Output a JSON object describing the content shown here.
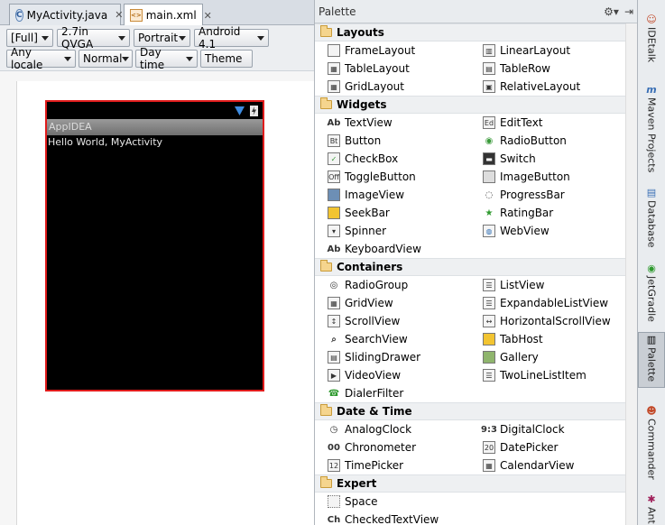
{
  "tabs": [
    {
      "label": "MyActivity.java",
      "icon": "java-class-icon"
    },
    {
      "label": "main.xml",
      "icon": "xml-file-icon"
    }
  ],
  "toolbar": {
    "row1": [
      "[Full]",
      "2.7in QVGA",
      "Portrait",
      "Android 4.1"
    ],
    "row2": [
      "Any locale",
      "Normal",
      "Day time",
      "Theme"
    ]
  },
  "device": {
    "app_title": "AppIDEA",
    "content_text": "Hello World, MyActivity",
    "border_color": "#e01b1b"
  },
  "palette": {
    "title": "Palette",
    "groups": [
      {
        "name": "Layouts",
        "items": [
          "FrameLayout",
          "LinearLayout",
          "TableLayout",
          "TableRow",
          "GridLayout",
          "RelativeLayout"
        ]
      },
      {
        "name": "Widgets",
        "items": [
          "TextView",
          "EditText",
          "Button",
          "RadioButton",
          "CheckBox",
          "Switch",
          "ToggleButton",
          "ImageButton",
          "ImageView",
          "ProgressBar",
          "SeekBar",
          "RatingBar",
          "Spinner",
          "WebView",
          "KeyboardView"
        ]
      },
      {
        "name": "Containers",
        "items": [
          "RadioGroup",
          "ListView",
          "GridView",
          "ExpandableListView",
          "ScrollView",
          "HorizontalScrollView",
          "SearchView",
          "TabHost",
          "SlidingDrawer",
          "Gallery",
          "VideoView",
          "TwoLineListItem",
          "DialerFilter"
        ]
      },
      {
        "name": "Date & Time",
        "items": [
          "AnalogClock",
          "DigitalClock",
          "Chronometer",
          "DatePicker",
          "TimePicker",
          "CalendarView"
        ]
      },
      {
        "name": "Expert",
        "items": [
          "Space",
          "CheckedTextView"
        ]
      }
    ]
  },
  "tool_windows": [
    "IDEtalk",
    "Maven Projects",
    "Database",
    "JetGradle",
    "Palette",
    "Commander",
    "Ant"
  ]
}
